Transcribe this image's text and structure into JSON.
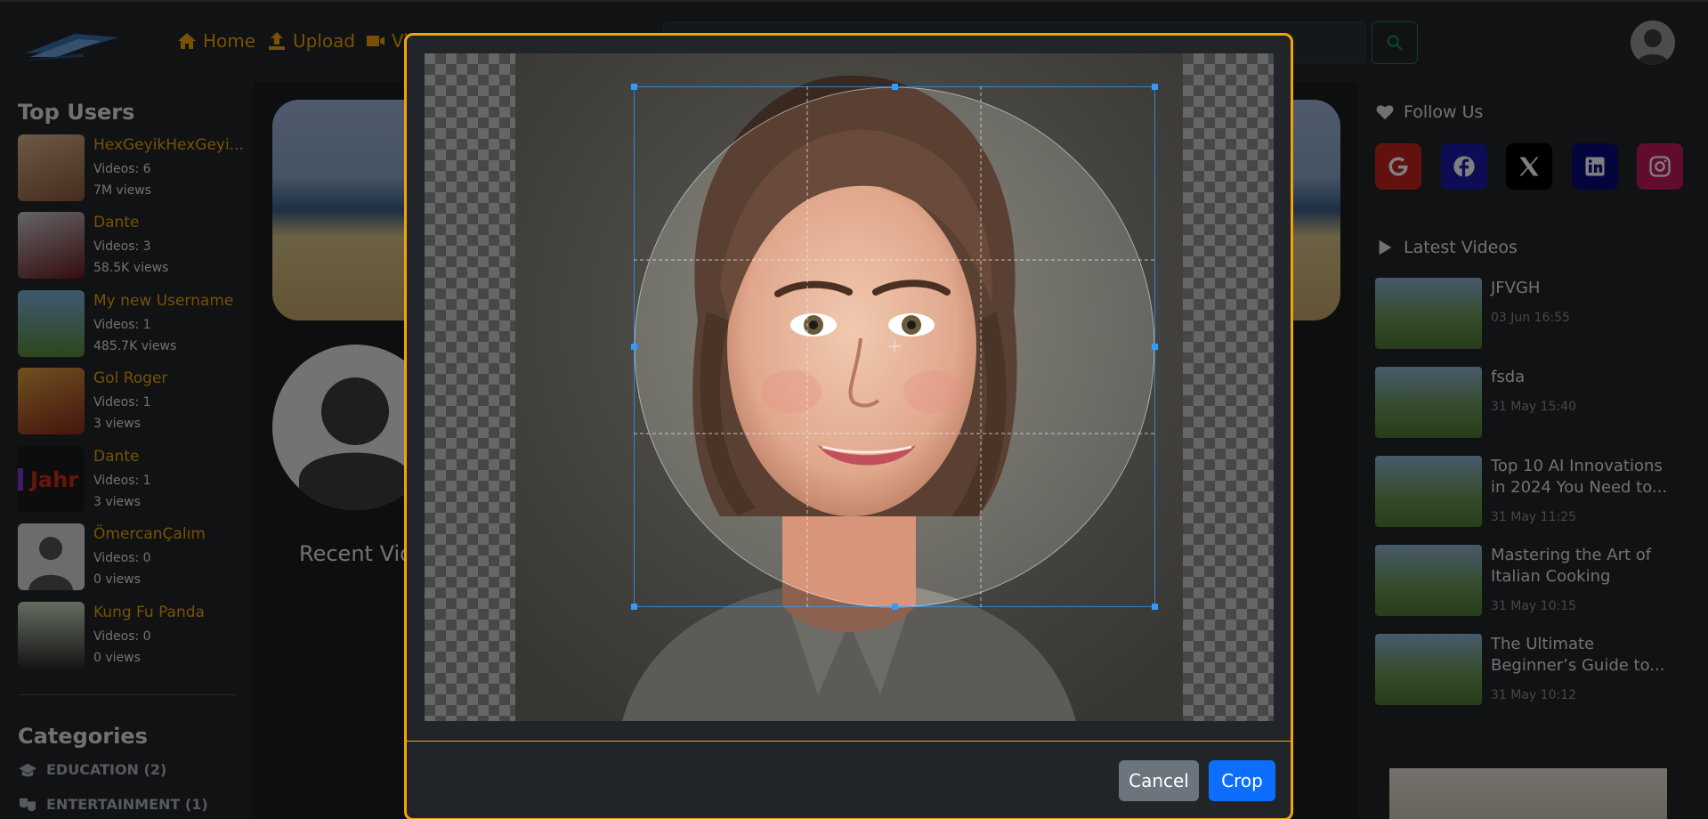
{
  "nav": {
    "home": "Home",
    "upload": "Upload",
    "videos_partial": "Vi"
  },
  "top_users": {
    "title": "Top Users",
    "items": [
      {
        "name": "HexGeyikHexGeyi...",
        "videos": "Videos: 6",
        "views": "7M views"
      },
      {
        "name": "Dante",
        "videos": "Videos: 3",
        "views": "58.5K views"
      },
      {
        "name": "My new Username",
        "videos": "Videos: 1",
        "views": "485.7K views"
      },
      {
        "name": "Gol Roger",
        "videos": "Videos: 1",
        "views": "3 views"
      },
      {
        "name": "Dante",
        "videos": "Videos: 1",
        "views": "3 views"
      },
      {
        "name": "ÖmercanÇalım",
        "videos": "Videos: 0",
        "views": "0 views"
      },
      {
        "name": "Kung Fu Panda",
        "videos": "Videos: 0",
        "views": "0 views"
      }
    ]
  },
  "categories": {
    "title": "Categories",
    "items": [
      "EDUCATION (2)",
      "ENTERTAINMENT (1)"
    ]
  },
  "center": {
    "recent_title": "Recent Vid"
  },
  "follow": {
    "title": "Follow Us",
    "socials": [
      {
        "name": "google",
        "color": "#c5221f"
      },
      {
        "name": "facebook",
        "color": "#1a1aaa"
      },
      {
        "name": "x",
        "color": "#000000"
      },
      {
        "name": "linkedin",
        "color": "#0b0b7a"
      },
      {
        "name": "instagram",
        "color": "#c2185b"
      }
    ]
  },
  "latest_videos": {
    "title": "Latest Videos",
    "items": [
      {
        "title": "JFVGH",
        "date": "03 Jun 16:55"
      },
      {
        "title": "fsda",
        "date": "31 May 15:40"
      },
      {
        "title": "Top 10 AI Innovations in 2024 You Need to...",
        "date": "31 May 11:25"
      },
      {
        "title": "Mastering the Art of Italian Cooking",
        "date": "31 May 10:15"
      },
      {
        "title": "The Ultimate Beginner’s Guide to...",
        "date": "31 May 10:12"
      }
    ]
  },
  "modal": {
    "cancel_label": "Cancel",
    "crop_label": "Crop"
  },
  "colors": {
    "accent": "#f0a30a",
    "primary": "#0d6efd",
    "secondary": "#6c757d",
    "crop_guide": "#3399ff"
  }
}
